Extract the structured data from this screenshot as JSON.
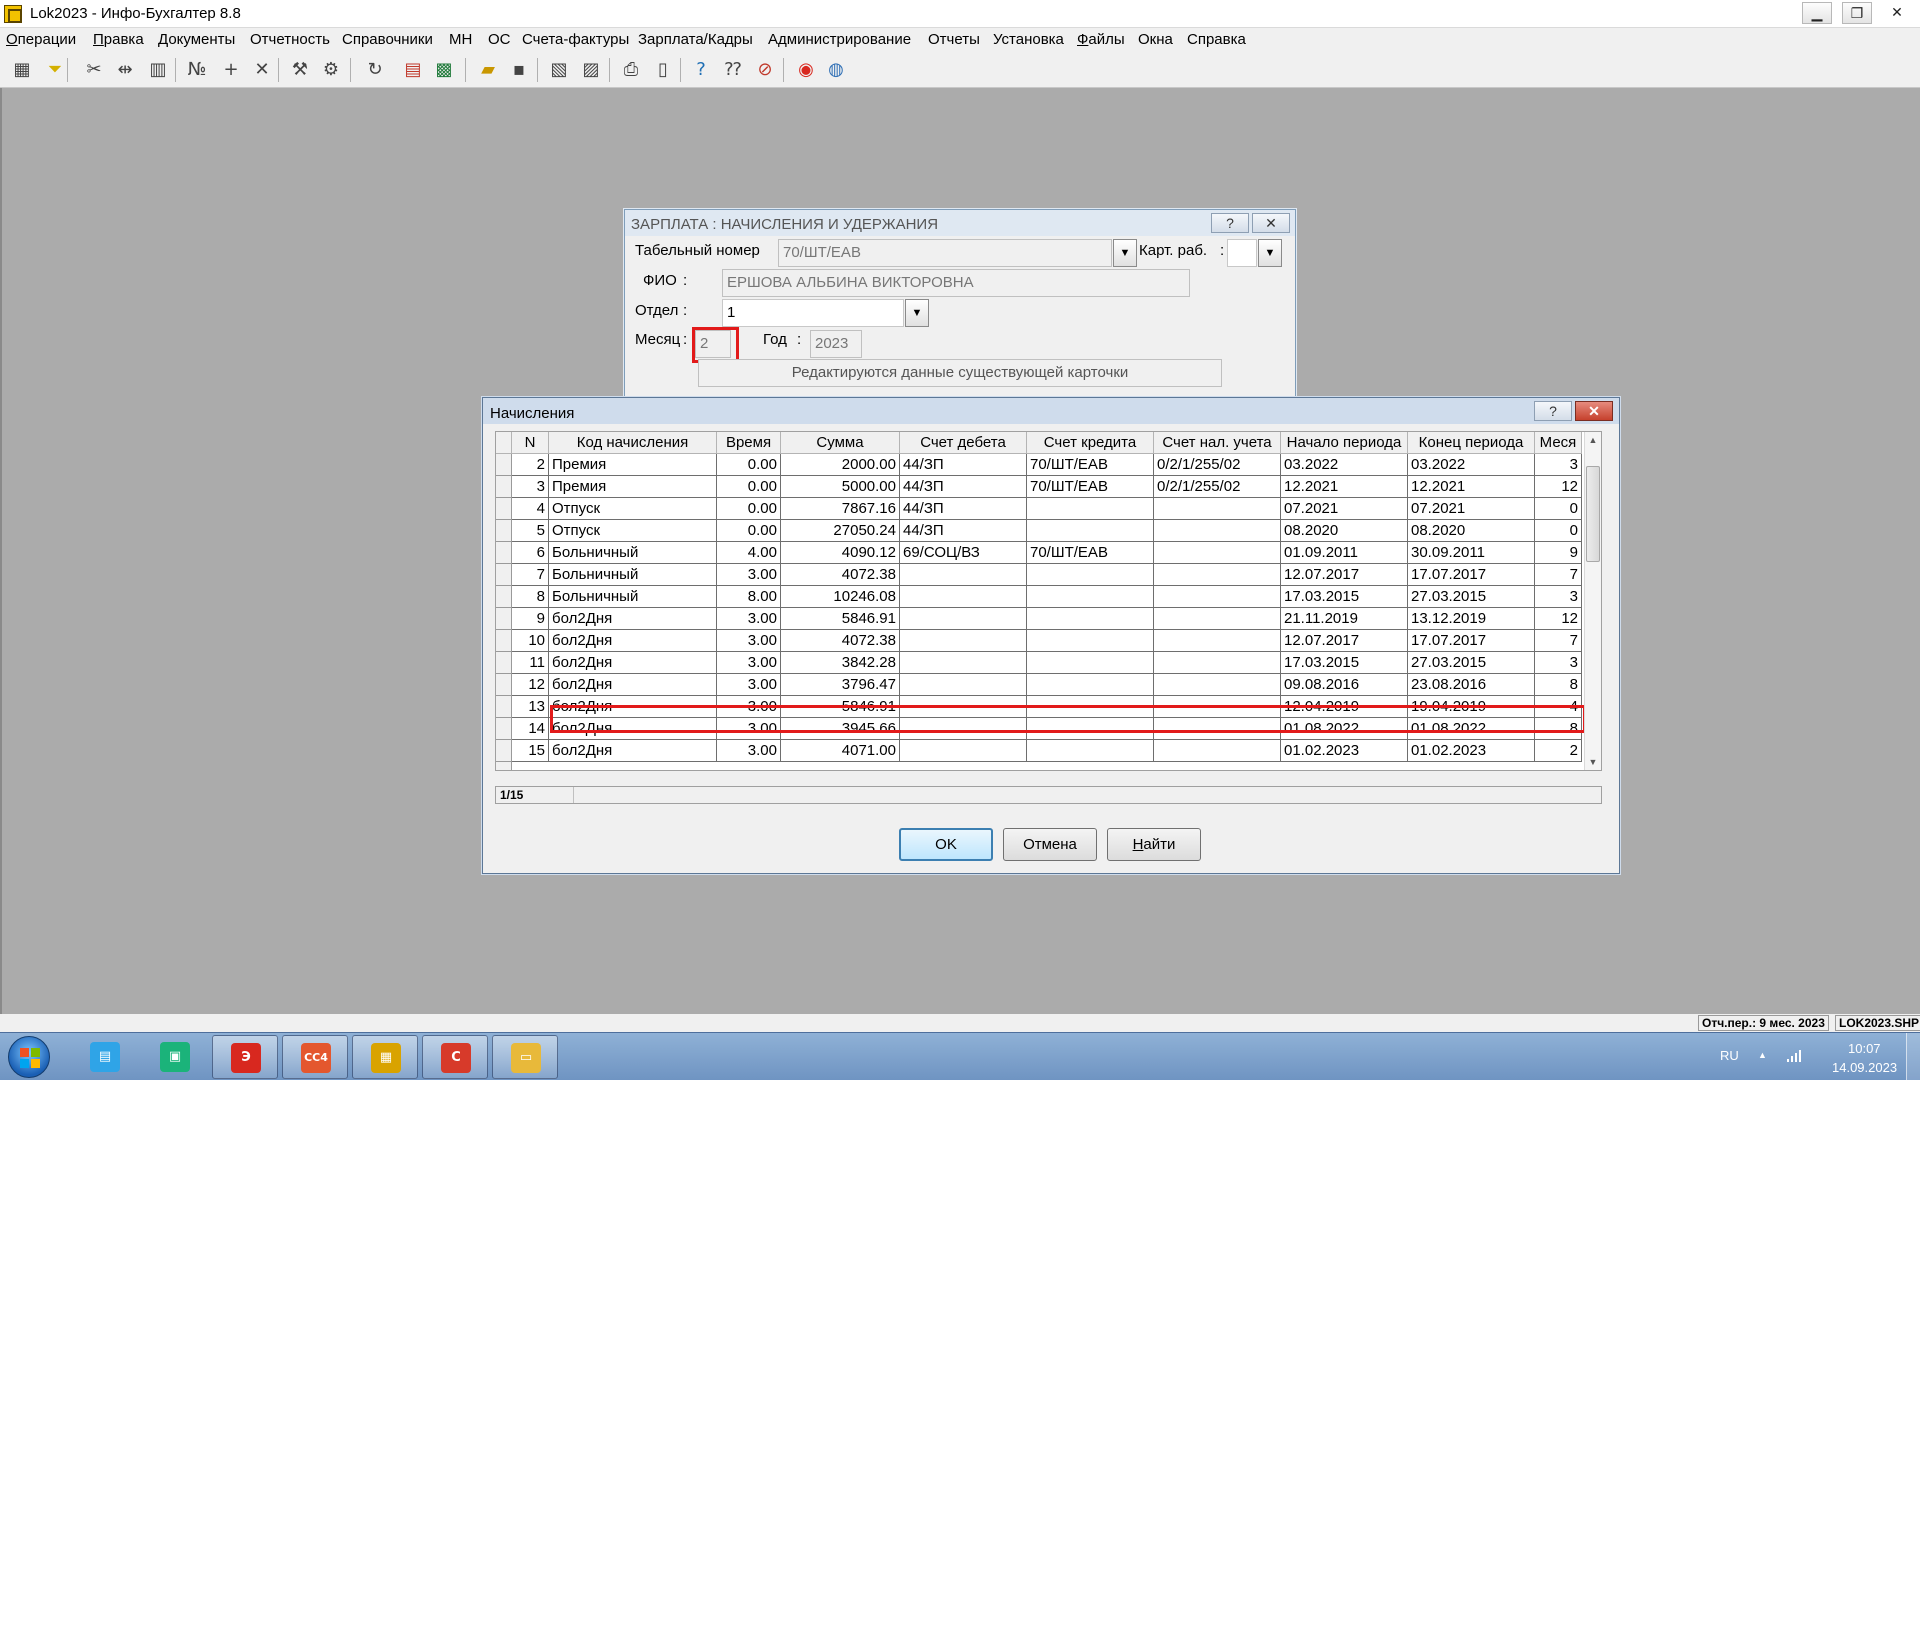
{
  "window": {
    "title": "Lok2023 - Инфо-Бухгалтер 8.8",
    "minimize": "▁",
    "restore": "❐",
    "close": "✕"
  },
  "menu": [
    {
      "label": "Операции",
      "acc": "О",
      "rest": "перации"
    },
    {
      "label": "Правка",
      "acc": "П",
      "rest": "равка"
    },
    {
      "label": "Документы",
      "acc": "Д",
      "rest": "окументы"
    },
    {
      "label": "Отчетность",
      "acc": "",
      "rest": "Отчетность"
    },
    {
      "label": "Справочники",
      "acc": "",
      "rest": "Справочники"
    },
    {
      "label": "МН",
      "acc": "",
      "rest": "МН"
    },
    {
      "label": "ОС",
      "acc": "",
      "rest": "ОС"
    },
    {
      "label": "Счета-фактуры",
      "acc": "",
      "rest": "Счета-фактуры"
    },
    {
      "label": "Зарплата/Кадры",
      "acc": "",
      "rest": "Зарплата/Кадры"
    },
    {
      "label": "Администрирование",
      "acc": "",
      "rest": "Администрирование"
    },
    {
      "label": "Отчеты",
      "acc": "",
      "rest": "Отчеты"
    },
    {
      "label": "Установка",
      "acc": "",
      "rest": "Установка"
    },
    {
      "label": "Файлы",
      "acc": "Ф",
      "rest": "айлы"
    },
    {
      "label": "Окна",
      "acc": "",
      "rest": "Окна"
    },
    {
      "label": "Справка",
      "acc": "",
      "rest": "Справка"
    }
  ],
  "toolbar_icons": [
    "table-view-icon",
    "filter-icon",
    "cut-icon",
    "move-icon",
    "paste-icon",
    "numbering-icon",
    "add-icon",
    "delete-icon",
    "tool-a-icon",
    "tool-b-icon",
    "refresh-icon",
    "calendar-icon",
    "calculator-icon",
    "open-folder-icon",
    "save-icon",
    "export-icon",
    "print-setup-icon",
    "print-icon",
    "preview-icon",
    "help-icon",
    "context-help-icon",
    "compass-icon",
    "lifebuoy-icon",
    "network-icon"
  ],
  "salary_dialog": {
    "title": "ЗАРПЛАТА : НАЧИСЛЕНИЯ И УДЕРЖАНИЯ",
    "help": "?",
    "close": "✕",
    "tab_label": "Табельный номер",
    "tab_value": "70/ШТ/ЕАВ",
    "card_label": "Карт. раб.",
    "card_colon": ":",
    "fio_label": "ФИО",
    "fio_value": "ЕРШОВА АЛЬБИНА ВИКТОРОВНА",
    "dept_label": "Отдел",
    "dept_value": "1",
    "month_label": "Месяц",
    "month_value": "2",
    "year_label": "Год",
    "year_value": "2023",
    "notice": "Редактируются данные существующей карточки",
    "colon": ":"
  },
  "accruals_dialog": {
    "title": "Начисления",
    "help": "?",
    "close": "✕",
    "columns": [
      "N",
      "Код начисления",
      "Время",
      "Сумма",
      "Счет дебета",
      "Счет кредита",
      "Счет нал. учета",
      "Начало периода",
      "Конец периода",
      "Меся"
    ],
    "rows": [
      [
        "2",
        "Премия",
        "0.00",
        "2000.00",
        "44/ЗП",
        "70/ШТ/ЕАВ",
        "0/2/1/255/02",
        "03.2022",
        "03.2022",
        "3"
      ],
      [
        "3",
        "Премия",
        "0.00",
        "5000.00",
        "44/ЗП",
        "70/ШТ/ЕАВ",
        "0/2/1/255/02",
        "12.2021",
        "12.2021",
        "12"
      ],
      [
        "4",
        "Отпуск",
        "0.00",
        "7867.16",
        "44/ЗП",
        "",
        "",
        "07.2021",
        "07.2021",
        "0"
      ],
      [
        "5",
        "Отпуск",
        "0.00",
        "27050.24",
        "44/ЗП",
        "",
        "",
        "08.2020",
        "08.2020",
        "0"
      ],
      [
        "6",
        "Больничный",
        "4.00",
        "4090.12",
        "69/СОЦ/ВЗ",
        "70/ШТ/ЕАВ",
        "",
        "01.09.2011",
        "30.09.2011",
        "9"
      ],
      [
        "7",
        "Больничный",
        "3.00",
        "4072.38",
        "",
        "",
        "",
        "12.07.2017",
        "17.07.2017",
        "7"
      ],
      [
        "8",
        "Больничный",
        "8.00",
        "10246.08",
        "",
        "",
        "",
        "17.03.2015",
        "27.03.2015",
        "3"
      ],
      [
        "9",
        "бол2Дня",
        "3.00",
        "5846.91",
        "",
        "",
        "",
        "21.11.2019",
        "13.12.2019",
        "12"
      ],
      [
        "10",
        "бол2Дня",
        "3.00",
        "4072.38",
        "",
        "",
        "",
        "12.07.2017",
        "17.07.2017",
        "7"
      ],
      [
        "11",
        "бол2Дня",
        "3.00",
        "3842.28",
        "",
        "",
        "",
        "17.03.2015",
        "27.03.2015",
        "3"
      ],
      [
        "12",
        "бол2Дня",
        "3.00",
        "3796.47",
        "",
        "",
        "",
        "09.08.2016",
        "23.08.2016",
        "8"
      ],
      [
        "13",
        "бол2Дня",
        "3.00",
        "5846.91",
        "",
        "",
        "",
        "12.04.2019",
        "19.04.2019",
        "4"
      ],
      [
        "14",
        "бол2Дня",
        "3.00",
        "3945.66",
        "",
        "",
        "",
        "01.08.2022",
        "01.08.2022",
        "8"
      ],
      [
        "15",
        "бол2Дня",
        "3.00",
        "4071.00",
        "",
        "",
        "",
        "01.02.2023",
        "01.02.2023",
        "2"
      ]
    ],
    "record_counter": "1/15",
    "ok_label": "OK",
    "cancel_label": "Отмена",
    "find_acc": "Н",
    "find_rest": "айти"
  },
  "status": {
    "period": "Отч.пер.: 9 мес. 2023",
    "file": "LOK2023.SHP"
  },
  "taskbar": {
    "apps": [
      {
        "name": "start-menu",
        "icon": "windows-logo-icon"
      },
      {
        "name": "messenger-blue",
        "icon": "chat-blue-icon",
        "color": "#2fa4e7",
        "glyph": "▤"
      },
      {
        "name": "messenger-green",
        "icon": "chat-green-icon",
        "color": "#1bb37a",
        "glyph": "▣"
      },
      {
        "name": "e-signature",
        "icon": "e-signature-icon",
        "color": "#d8281f",
        "glyph": "Э"
      },
      {
        "name": "cc4",
        "icon": "cc4-icon",
        "color": "#e4572e",
        "glyph": "CC4"
      },
      {
        "name": "info-accountant",
        "icon": "abacus-icon",
        "color": "#d9a300",
        "glyph": "▦"
      },
      {
        "name": "ccleaner",
        "icon": "ccleaner-icon",
        "color": "#d73a2a",
        "glyph": "C"
      },
      {
        "name": "explorer",
        "icon": "folder-icon",
        "color": "#e8b93a",
        "glyph": "▭"
      }
    ],
    "lang": "RU",
    "tray_up": "▲",
    "time": "10:07",
    "date": "14.09.2023"
  }
}
